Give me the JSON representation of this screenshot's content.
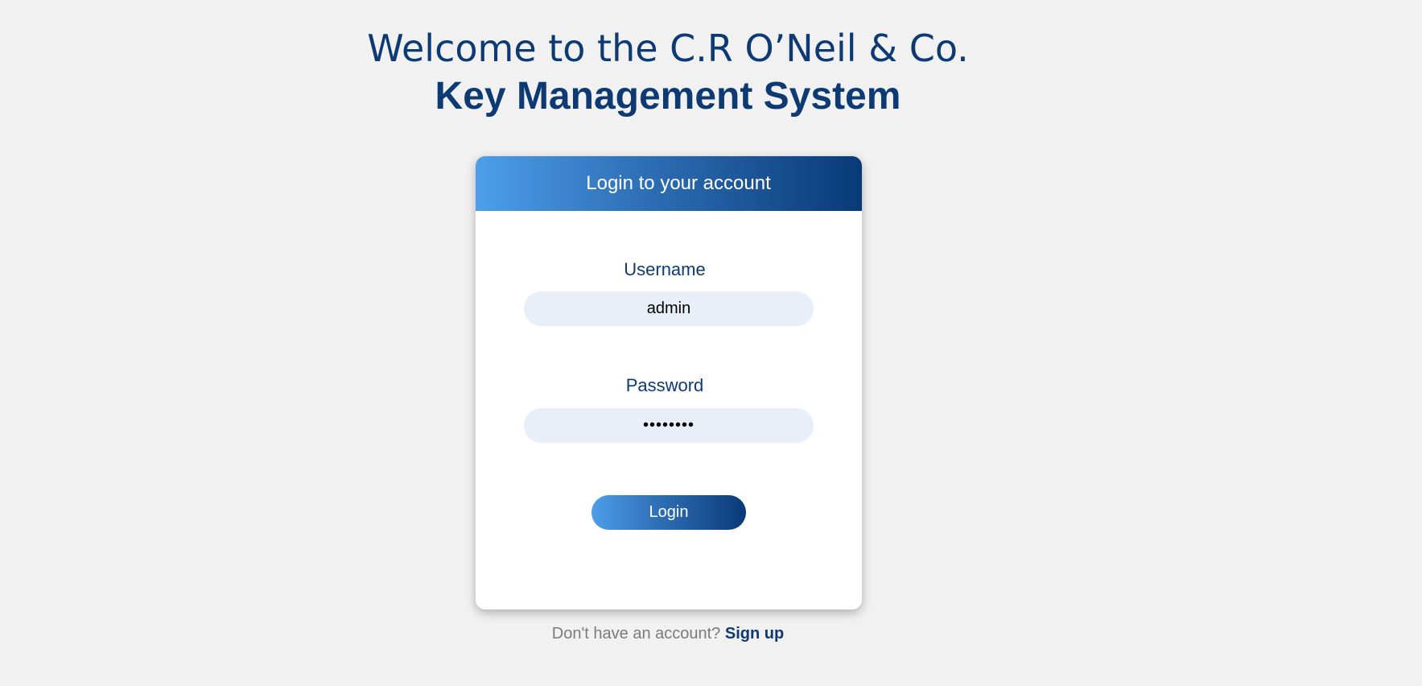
{
  "header": {
    "welcome": "Welcome to the C.R O’Neil & Co.",
    "system_name": "Key Management System"
  },
  "login_card": {
    "title": "Login to your account",
    "username": {
      "label": "Username",
      "value": "admin"
    },
    "password": {
      "label": "Password",
      "value": "••••••••"
    },
    "submit_label": "Login"
  },
  "footer": {
    "prompt": "Don't have an account?",
    "signup_label": "Sign up"
  },
  "colors": {
    "page_background": "#f1f1f1",
    "brand_dark": "#0d3a73",
    "brand_light": "#4d9ee9",
    "input_background": "#e8eff9"
  }
}
